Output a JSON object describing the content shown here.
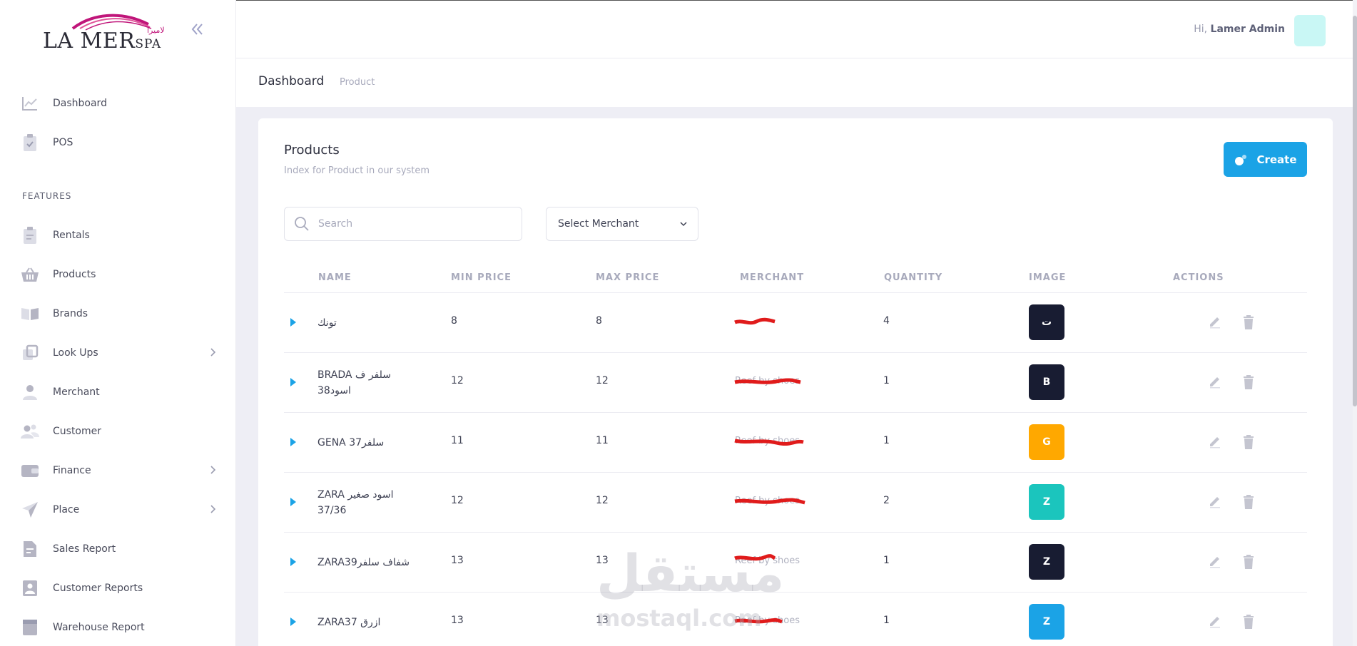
{
  "logo": {
    "text": "LA MER",
    "suffix": "SPA",
    "arabic": "لاميرا"
  },
  "sidebar": {
    "section_title": "FEATURES",
    "items": [
      {
        "label": "Dashboard",
        "icon": "chart-line-icon"
      },
      {
        "label": "POS",
        "icon": "clipboard-check-icon"
      },
      {
        "label": "Rentals",
        "icon": "clipboard-list-icon"
      },
      {
        "label": "Products",
        "icon": "basket-icon"
      },
      {
        "label": "Brands",
        "icon": "book-open-icon"
      },
      {
        "label": "Look Ups",
        "icon": "layers-icon"
      },
      {
        "label": "Merchant",
        "icon": "user-icon"
      },
      {
        "label": "Customer",
        "icon": "users-icon"
      },
      {
        "label": "Finance",
        "icon": "wallet-icon"
      },
      {
        "label": "Place",
        "icon": "send-icon"
      },
      {
        "label": "Sales Report",
        "icon": "file-icon"
      },
      {
        "label": "Customer Reports",
        "icon": "user-card-icon"
      },
      {
        "label": "Warehouse Report",
        "icon": "box-icon"
      }
    ]
  },
  "header": {
    "greeting_prefix": "Hi,",
    "user_name": "Lamer Admin"
  },
  "subheader": {
    "title": "Dashboard",
    "crumb": "Product"
  },
  "card": {
    "title": "Products",
    "description": "Index for Product in our system",
    "create_label": "Create",
    "search_placeholder": "Search",
    "merchant_select": "Select Merchant"
  },
  "table": {
    "columns": [
      "NAME",
      "MIN PRICE",
      "MAX PRICE",
      "MERCHANT",
      "QUANTITY",
      "IMAGE",
      "ACTIONS"
    ],
    "rows": [
      {
        "name": "تونك",
        "min": "8",
        "max": "8",
        "merchant": "",
        "qty": "4",
        "initial": "ت",
        "color": "#181c32"
      },
      {
        "name": "BRADA سلفر ف اسود38",
        "min": "12",
        "max": "12",
        "merchant": "Reef by shoes",
        "qty": "1",
        "initial": "B",
        "color": "#181c32"
      },
      {
        "name": "GENA 37سلفر",
        "min": "11",
        "max": "11",
        "merchant": "Reef by shoes",
        "qty": "1",
        "initial": "G",
        "color": "#ffa800"
      },
      {
        "name": "ZARA اسود صغير 37/36",
        "min": "12",
        "max": "12",
        "merchant": "Reef by shoes",
        "qty": "2",
        "initial": "Z",
        "color": "#1bc5bd"
      },
      {
        "name": "ZARA39شفاف سلفر",
        "min": "13",
        "max": "13",
        "merchant": "Reef by shoes",
        "qty": "1",
        "initial": "Z",
        "color": "#181c32"
      },
      {
        "name": "ZARA37 ازرق",
        "min": "13",
        "max": "13",
        "merchant": "Reef by shoes",
        "qty": "1",
        "initial": "Z",
        "color": "#1ba3e6"
      }
    ]
  },
  "watermark": {
    "arabic": "مستقل",
    "latin": "mostaql.com"
  }
}
